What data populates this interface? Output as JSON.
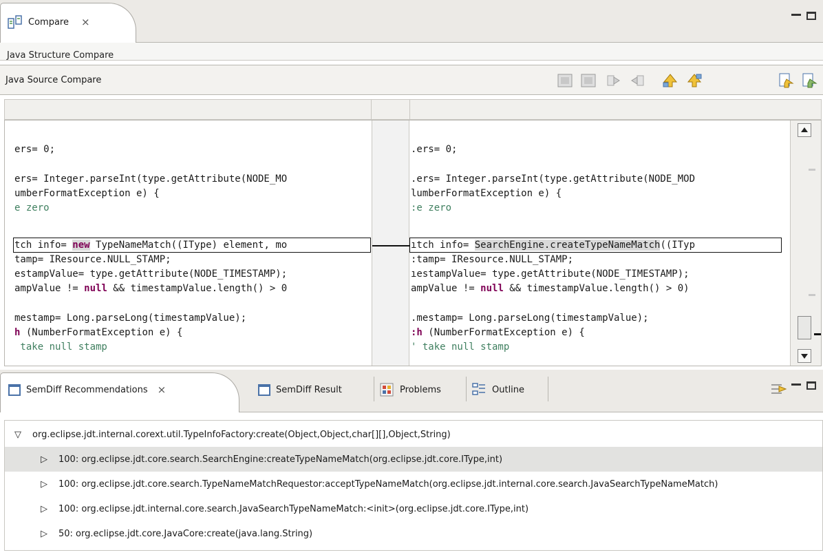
{
  "compare": {
    "tab_label": "Compare",
    "close_icon": "close-icon",
    "structure_title": "Java Structure Compare",
    "source_title": "Java Source Compare",
    "toolbar_icons": [
      "copy-all-right-icon",
      "copy-all-left-icon",
      "copy-current-right-icon",
      "copy-current-left-icon",
      "next-difference-icon",
      "previous-difference-icon",
      "next-change-icon",
      "previous-change-icon"
    ]
  },
  "left_code": {
    "l1": "ers= 0;",
    "l2": "ers= Integer.parseInt(type.getAttribute(NODE_MO",
    "l3": "umberFormatException e) {",
    "l4": "e zero",
    "l5a": "tch info= ",
    "l5b": "new",
    "l5c": " TypeNameMatch((IType) element, mo",
    "l6": "tamp= IResource.NULL_STAMP;",
    "l7": "estampValue= type.getAttribute(NODE_TIMESTAMP);",
    "l8a": "ampValue != ",
    "l8b": "null",
    "l8c": " && timestampValue.length() > 0",
    "l9": "mestamp= Long.parseLong(timestampValue);",
    "l10a": "h",
    "l10b": " (NumberFormatException e) {",
    "l11": " take null stamp"
  },
  "right_code": {
    "l1": ".ers= 0;",
    "l2": ".ers= Integer.parseInt(type.getAttribute(NODE_MOD",
    "l3": "lumberFormatException e) {",
    "l4": ":e zero",
    "l5a": "ıtch info= ",
    "l5b": "SearchEngine.createTypeNameMatch",
    "l5c": "((ITyp",
    "l6": ":tamp= IResource.NULL_STAMP;",
    "l7": "ıestampValue= type.getAttribute(NODE_TIMESTAMP);",
    "l8a": "ampValue != ",
    "l8b": "null",
    "l8c": " && timestampValue.length() > 0)",
    "l9": ".mestamp= Long.parseLong(timestampValue);",
    "l10a": ":h",
    "l10b": " (NumberFormatException e) {",
    "l11": "' take null stamp"
  },
  "bottom": {
    "tabs": [
      {
        "label": "SemDiff Recommendations",
        "icon": "view-icon"
      },
      {
        "label": "SemDiff Result",
        "icon": "view-icon"
      },
      {
        "label": "Problems",
        "icon": "problems-icon"
      },
      {
        "label": "Outline",
        "icon": "outline-icon"
      }
    ],
    "tree": {
      "root": "org.eclipse.jdt.internal.corext.util.TypeInfoFactory:create(Object,Object,char[][],Object,String)",
      "children": [
        "100: org.eclipse.jdt.core.search.SearchEngine:createTypeNameMatch(org.eclipse.jdt.core.IType,int)",
        "100: org.eclipse.jdt.core.search.TypeNameMatchRequestor:acceptTypeNameMatch(org.eclipse.jdt.internal.core.search.JavaSearchTypeNameMatch)",
        "100: org.eclipse.jdt.internal.core.search.JavaSearchTypeNameMatch:<init>(org.eclipse.jdt.core.IType,int)",
        "50: org.eclipse.jdt.core.JavaCore:create(java.lang.String)"
      ],
      "selected_index": 0
    }
  }
}
